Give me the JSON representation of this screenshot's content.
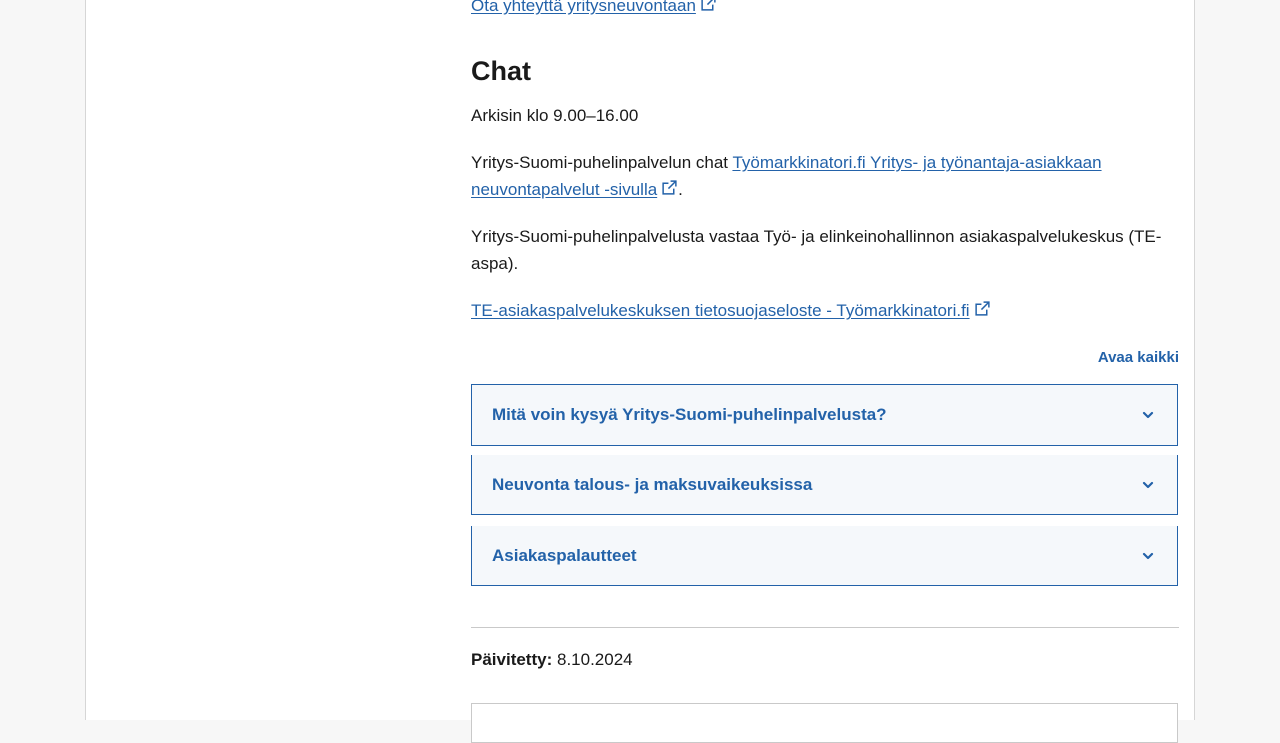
{
  "contact_link": {
    "label": "Ota yhteyttä yritysneuvontaan"
  },
  "chat_section": {
    "heading": "Chat",
    "hours": "Arkisin klo 9.00–16.00",
    "chat_text_prefix": "Yritys-Suomi-puhelinpalvelun chat ",
    "chat_link_line1": "Työmarkkinatori.fi Yritys- ja työnantaja-asiakkaan",
    "chat_link_line2": "neuvontapalvelut -sivulla",
    "chat_text_suffix": ".",
    "responsible_text": "Yritys-Suomi-puhelinpalvelusta vastaa Työ- ja elinkeinohallinnon asiakaspalvelukeskus (TE-aspa).",
    "privacy_link": "TE-asiakaspalvelukeskuksen tietosuojaseloste - Työmarkkinatori.fi"
  },
  "accordions": {
    "open_all": "Avaa kaikki",
    "items": [
      {
        "label": "Mitä voin kysyä Yritys-Suomi-puhelinpalvelusta?"
      },
      {
        "label": "Neuvonta talous- ja maksuvaikeuksissa"
      },
      {
        "label": "Asiakaspalautteet"
      }
    ]
  },
  "footer": {
    "updated_label": "Päivitetty:",
    "updated_date": "8.10.2024"
  },
  "icons": {
    "external": "external-link-icon",
    "chevron": "chevron-down-icon"
  },
  "colors": {
    "link": "#2362a9",
    "accordion_bg": "#f5f8fb",
    "page_bg": "#f7f7f7"
  }
}
